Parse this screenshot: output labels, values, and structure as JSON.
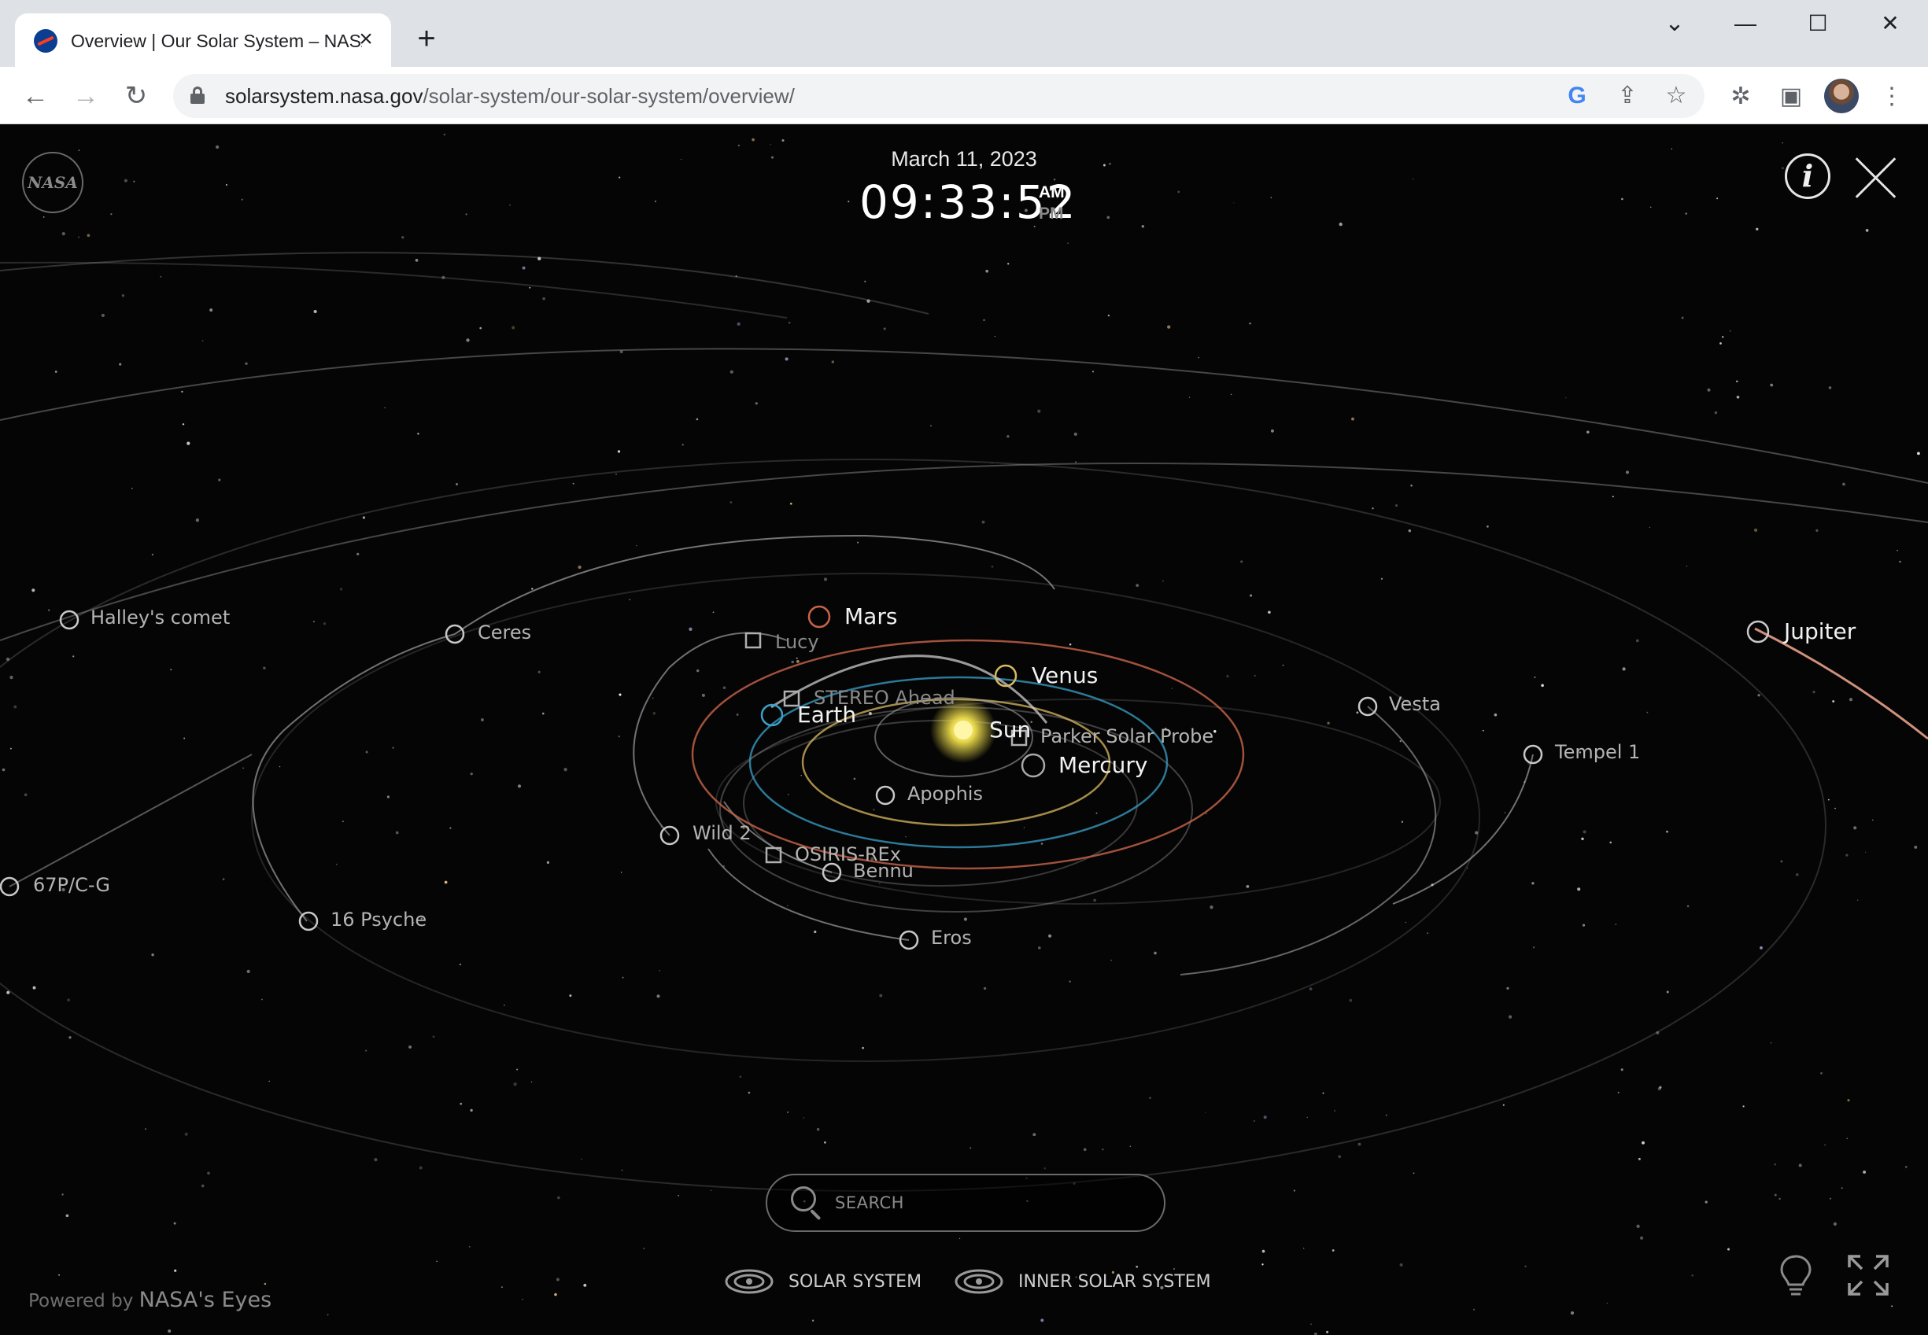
{
  "browser": {
    "tab": {
      "title": "Overview | Our Solar System – NASA Solar System Exploration",
      "favicon": "nasa-favicon",
      "close": "×"
    },
    "new_tab": "+",
    "window": {
      "minimize": "—",
      "maximize": "☐",
      "close": "✕",
      "tab_search": "⌄"
    },
    "toolbar": {
      "back": "←",
      "forward": "→",
      "reload": "↻",
      "url_host": "solarsystem.nasa.gov",
      "url_path": "/solar-system/our-solar-system/overview/",
      "google": "G",
      "share": "⇪",
      "bookmark": "☆",
      "extensions": "✲",
      "sidepanel": "▣",
      "menu": "⋮"
    }
  },
  "eyes": {
    "nasa_logo": "NASA",
    "date": "March 11, 2023",
    "time": "09:33:52",
    "am": "AM",
    "pm": "PM",
    "info": "i",
    "search": {
      "placeholder": "SEARCH"
    },
    "views": {
      "solar_system": "SOLAR SYSTEM",
      "inner_solar_system": "INNER SOLAR SYSTEM"
    },
    "powered_prefix": "Powered by",
    "powered_brand": "NASA's Eyes",
    "bodies": {
      "sun": "Sun",
      "mercury": "Mercury",
      "venus": "Venus",
      "earth": "Earth",
      "mars": "Mars",
      "jupiter": "Jupiter",
      "ceres": "Ceres",
      "vesta": "Vesta",
      "halley": "Halley's comet",
      "psyche": "16 Psyche",
      "comet_67p": "67P/C-G",
      "tempel": "Tempel 1",
      "wild2": "Wild 2",
      "apophis": "Apophis",
      "bennu": "Bennu",
      "eros": "Eros"
    },
    "spacecraft": {
      "lucy": "Lucy",
      "stereo": "STEREO Ahead",
      "parker": "Parker Solar Probe",
      "osiris": "OSIRIS-REx"
    },
    "colors": {
      "sun": "#e8d84a",
      "earth_orbit": "#3aa0c8",
      "venus_orbit": "#d8b860",
      "mars_orbit": "#c8644a",
      "jupiter_orbit": "#e8a08a",
      "generic_orbit": "#9a9a9a"
    }
  }
}
